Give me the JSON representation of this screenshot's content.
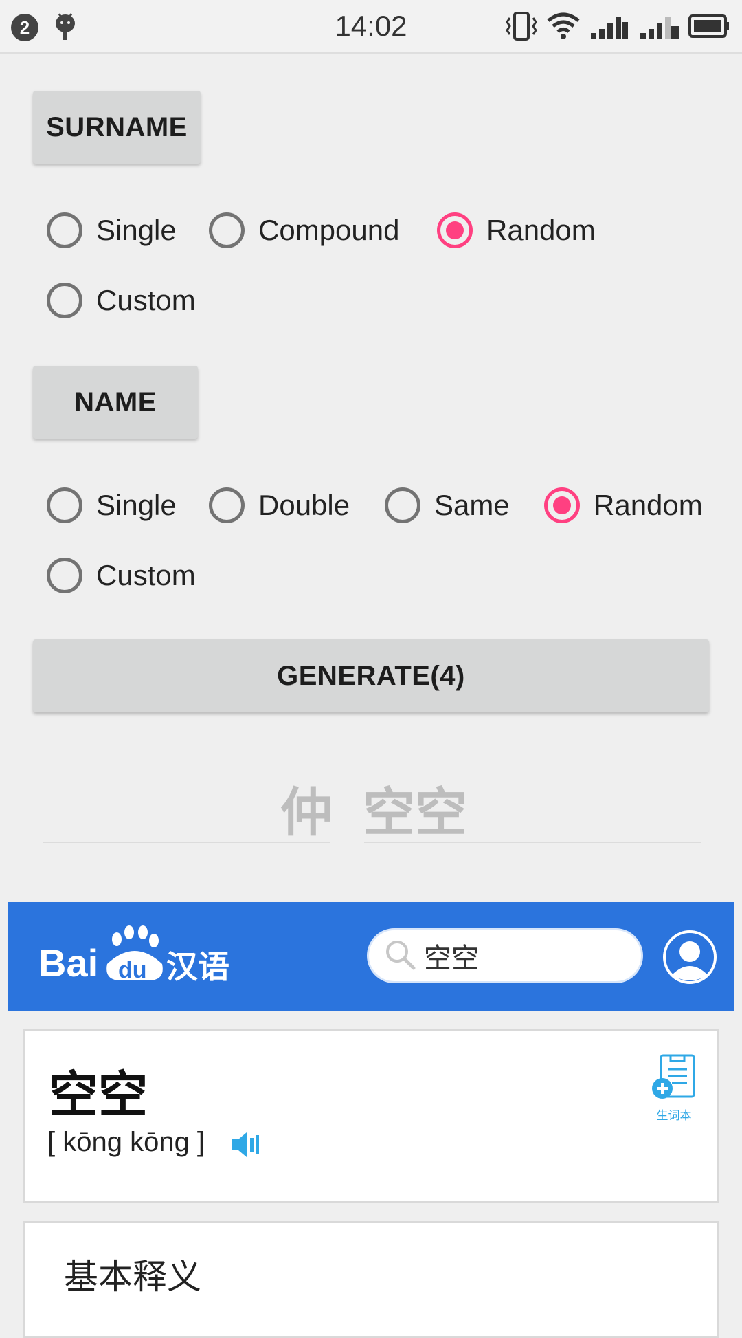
{
  "status_bar": {
    "notification_count": "2",
    "time": "14:02",
    "icons": [
      "android-debug-icon",
      "vibrate-icon",
      "wifi-icon",
      "signal-1-icon",
      "signal-2-icon",
      "battery-icon"
    ]
  },
  "surname_section": {
    "button_label": "SURNAME",
    "options": [
      {
        "label": "Single",
        "checked": false
      },
      {
        "label": "Compound",
        "checked": false
      },
      {
        "label": "Random",
        "checked": true
      },
      {
        "label": "Custom",
        "checked": false
      }
    ]
  },
  "name_section": {
    "button_label": "NAME",
    "options": [
      {
        "label": "Single",
        "checked": false
      },
      {
        "label": "Double",
        "checked": false
      },
      {
        "label": "Same",
        "checked": false
      },
      {
        "label": "Random",
        "checked": true
      },
      {
        "label": "Custom",
        "checked": false
      }
    ]
  },
  "generate_button": {
    "label": "GENERATE(4)"
  },
  "result": {
    "surname": "仲",
    "given_name": "空空"
  },
  "baidu": {
    "logo_text": "Bai du 汉语",
    "search_value": "空空",
    "brand_color": "#2b74dd"
  },
  "word_card": {
    "word": "空空",
    "pinyin": "[ kōng kōng ]",
    "vocab_label": "生词本"
  },
  "definition": {
    "title": "基本释义"
  },
  "colors": {
    "accent": "#ff4081",
    "button_bg": "#d6d7d7",
    "background": "#efefef"
  }
}
